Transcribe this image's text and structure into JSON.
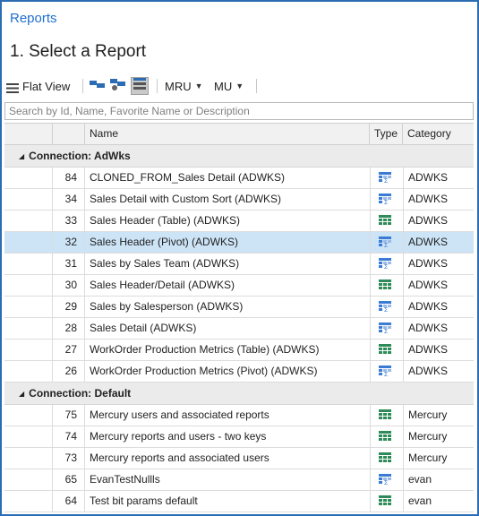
{
  "header": {
    "link": "Reports",
    "title": "1. Select a Report"
  },
  "toolbar": {
    "flat_view": "Flat View",
    "mru": "MRU",
    "mu": "MU"
  },
  "search": {
    "placeholder": "Search by Id, Name, Favorite Name or Description"
  },
  "columns": {
    "name": "Name",
    "type": "Type",
    "category": "Category"
  },
  "groups": [
    {
      "label": "Connection: AdWks",
      "rows": [
        {
          "id": "84",
          "name": "CLONED_FROM_Sales Detail (ADWKS)",
          "type": "pivot-icon",
          "category": "ADWKS"
        },
        {
          "id": "34",
          "name": "Sales Detail with Custom Sort (ADWKS)",
          "type": "pivot-icon",
          "category": "ADWKS"
        },
        {
          "id": "33",
          "name": "Sales Header (Table) (ADWKS)",
          "type": "table-icon",
          "category": "ADWKS"
        },
        {
          "id": "32",
          "name": "Sales Header (Pivot) (ADWKS)",
          "type": "pivot-icon",
          "category": "ADWKS",
          "selected": true
        },
        {
          "id": "31",
          "name": "Sales by Sales Team (ADWKS)",
          "type": "pivot-icon",
          "category": "ADWKS"
        },
        {
          "id": "30",
          "name": "Sales Header/Detail (ADWKS)",
          "type": "table-icon",
          "category": "ADWKS"
        },
        {
          "id": "29",
          "name": "Sales by Salesperson (ADWKS)",
          "type": "pivot-icon",
          "category": "ADWKS"
        },
        {
          "id": "28",
          "name": "Sales Detail (ADWKS)",
          "type": "pivot-icon",
          "category": "ADWKS"
        },
        {
          "id": "27",
          "name": "WorkOrder Production Metrics (Table) (ADWKS)",
          "type": "table-icon",
          "category": "ADWKS"
        },
        {
          "id": "26",
          "name": "WorkOrder Production Metrics (Pivot) (ADWKS)",
          "type": "pivot-icon",
          "category": "ADWKS"
        }
      ]
    },
    {
      "label": "Connection: Default",
      "rows": [
        {
          "id": "75",
          "name": "Mercury users and associated reports",
          "type": "table-icon",
          "category": "Mercury"
        },
        {
          "id": "74",
          "name": "Mercury reports and users - two keys",
          "type": "table-icon",
          "category": "Mercury"
        },
        {
          "id": "73",
          "name": "Mercury reports and associated users",
          "type": "table-icon",
          "category": "Mercury"
        },
        {
          "id": "65",
          "name": "EvanTestNullls",
          "type": "pivot-icon",
          "category": "evan"
        },
        {
          "id": "64",
          "name": "Test bit params default",
          "type": "table-icon",
          "category": "evan"
        }
      ]
    }
  ],
  "colors": {
    "accent": "#1f6fd0",
    "selected_row": "#cde4f7",
    "table_icon": "#2e8b57",
    "pivot_icon": "#3a7bd5"
  }
}
